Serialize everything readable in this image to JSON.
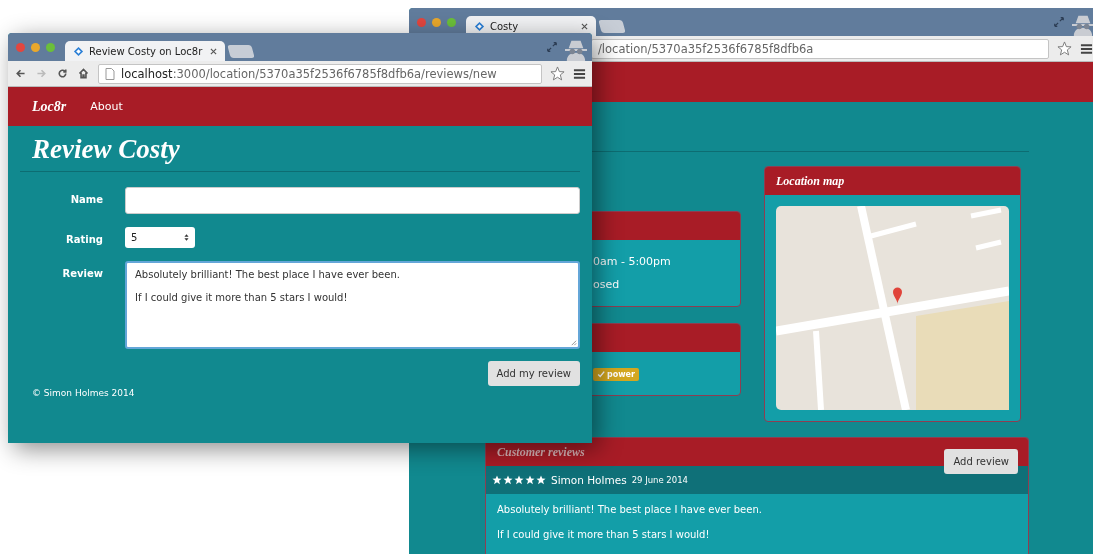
{
  "back_window": {
    "tab": {
      "title": "Costy",
      "selected": true
    },
    "url": "/location/5370a35f2536f6785f8dfb6a",
    "hours": [
      "0am - 5:00pm",
      "osed"
    ],
    "facilities": [
      {
        "label": "power"
      }
    ],
    "map_panel": {
      "title": "Location map"
    },
    "reviews_panel": {
      "title": "Customer reviews",
      "button": "Add review",
      "reviews": [
        {
          "stars": 5,
          "author": "Simon Holmes",
          "date": "29 June 2014",
          "paragraphs": [
            "Absolutely brilliant! The best place I have ever been.",
            "If I could give it more than 5 stars I would!"
          ]
        }
      ]
    }
  },
  "front_window": {
    "tab": {
      "title": "Review Costy on Loc8r",
      "selected": true
    },
    "nav_buttons": [
      {
        "kind": "back",
        "disabled": false
      },
      {
        "kind": "forward",
        "disabled": true
      },
      {
        "kind": "reload",
        "disabled": false
      },
      {
        "kind": "home",
        "disabled": false
      }
    ],
    "url_host": "localhost",
    "url_path": ":3000/location/5370a35f2536f6785f8dfb6a/reviews/new",
    "nav": {
      "brand": "Loc8r",
      "links": [
        "About"
      ]
    },
    "heading": "Review Costy",
    "form": {
      "fields": [
        {
          "kind": "text",
          "label": "Name"
        },
        {
          "kind": "select",
          "label": "Rating",
          "value": "5"
        },
        {
          "kind": "textarea",
          "label": "Review",
          "paragraphs": [
            "Absolutely brilliant! The best place I have ever been.",
            "If I could give it more than 5 stars I would!"
          ]
        }
      ],
      "submit": "Add my review"
    },
    "footer": "© Simon Holmes 2014"
  }
}
